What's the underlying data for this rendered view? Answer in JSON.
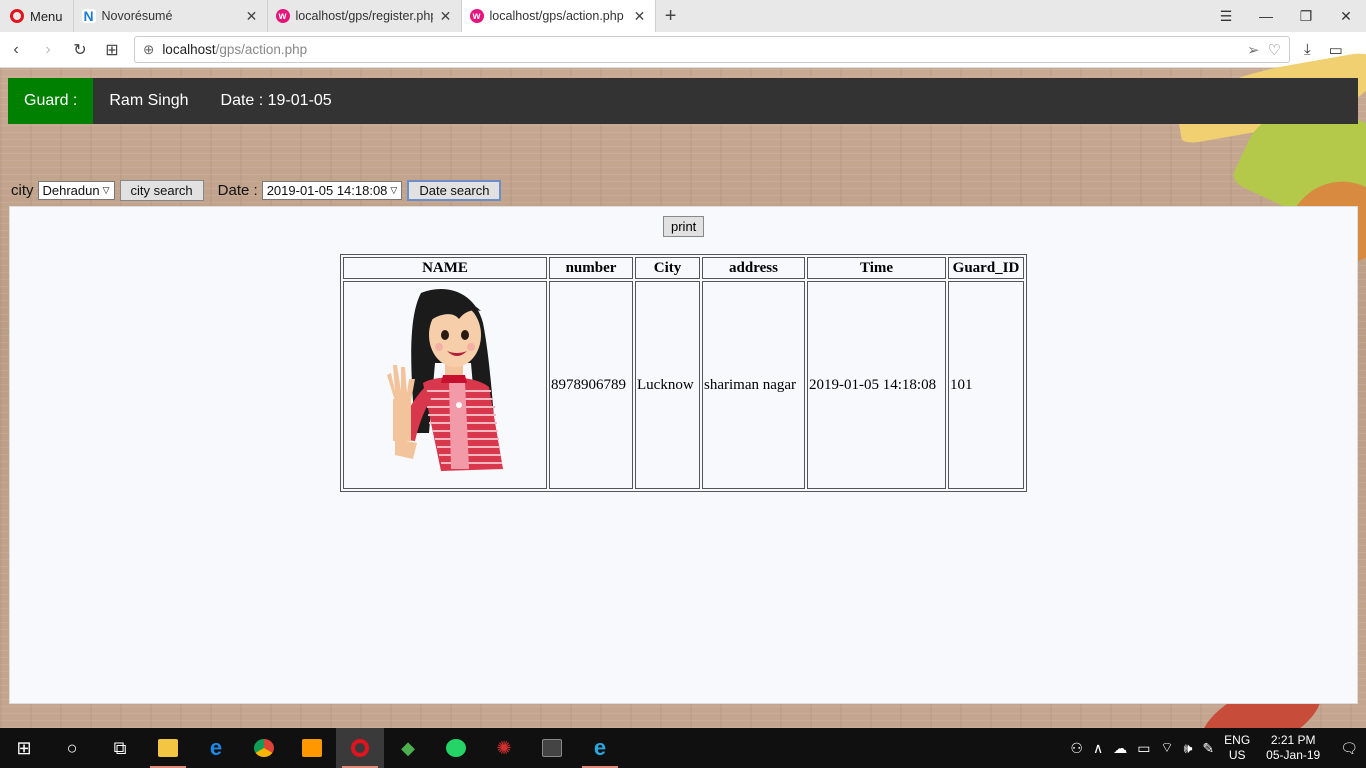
{
  "browser": {
    "menu_label": "Menu",
    "tabs": [
      {
        "label": "Novorésumé",
        "icon": "novoresume-favicon",
        "active": false
      },
      {
        "label": "localhost/gps/register.php",
        "icon": "wamp-favicon",
        "active": false
      },
      {
        "label": "localhost/gps/action.php",
        "icon": "wamp-favicon",
        "active": true
      }
    ],
    "url_host": "localhost",
    "url_path": "/gps/action.php"
  },
  "header": {
    "guard_label": "Guard :",
    "guard_name": "Ram Singh",
    "date_text": "Date : 19-01-05"
  },
  "filters": {
    "city_label": "city",
    "city_selected": "Dehradun",
    "city_search_label": "city search",
    "date_label": "Date :",
    "date_selected": "2019-01-05 14:18:08",
    "date_search_label": "Date search"
  },
  "print_label": "print",
  "table": {
    "columns": [
      "NAME",
      "number",
      "City",
      "address",
      "Time",
      "Guard_ID"
    ],
    "rows": [
      {
        "name_image": "cartoon-girl-waving",
        "number": "8978906789",
        "city": "Lucknow",
        "address": "shariman nagar",
        "time": "2019-01-05 14:18:08",
        "guard_id": "101"
      }
    ]
  },
  "taskbar": {
    "lang_top": "ENG",
    "lang_bottom": "US",
    "time": "2:21 PM",
    "date": "05-Jan-19"
  },
  "colors": {
    "nav_bg": "#333333",
    "guard_bg": "#008000",
    "panel_bg": "#f8f9fd"
  }
}
